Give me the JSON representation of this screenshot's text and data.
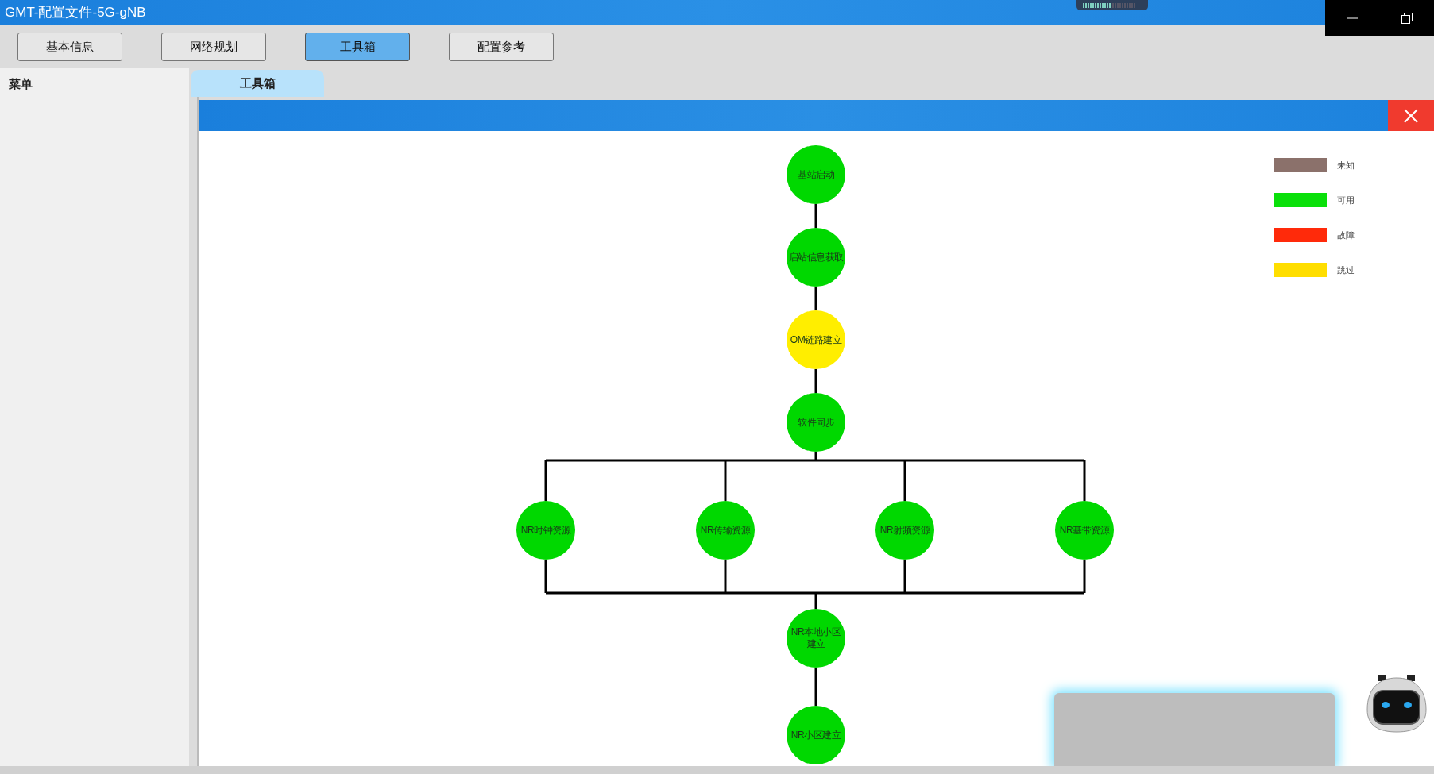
{
  "window": {
    "title": "GMT-配置文件-5G-gNB"
  },
  "nav_buttons": [
    {
      "label": "基本信息",
      "selected": false
    },
    {
      "label": "网络规划",
      "selected": false
    },
    {
      "label": "工具箱",
      "selected": true
    },
    {
      "label": "配置参考",
      "selected": false
    }
  ],
  "sidebar": {
    "title": "菜单"
  },
  "tabs": [
    {
      "label": "工具箱",
      "selected": true
    }
  ],
  "diagram": {
    "chain_top": [
      {
        "label": "基站启动",
        "color": "#00d800"
      },
      {
        "label": "启站信息获取",
        "color": "#00d800"
      },
      {
        "label": "OM链路建立",
        "color": "#ffee00"
      },
      {
        "label": "软件同步",
        "color": "#00d800"
      }
    ],
    "parallel": [
      {
        "label": "NR时钟资源",
        "color": "#00d800"
      },
      {
        "label": "NR传输资源",
        "color": "#00d800"
      },
      {
        "label": "NR射频资源",
        "color": "#00d800"
      },
      {
        "label": "NR基带资源",
        "color": "#00d800"
      }
    ],
    "chain_bottom": [
      {
        "label": "NR本地小区建立",
        "color": "#00d800"
      },
      {
        "label": "NR小区建立",
        "color": "#00d800"
      }
    ]
  },
  "legend": [
    {
      "label": "未知",
      "color": "#8b716b"
    },
    {
      "label": "可用",
      "color": "#0ae00a"
    },
    {
      "label": "故障",
      "color": "#ff2a0a"
    },
    {
      "label": "跳过",
      "color": "#ffde00"
    }
  ]
}
